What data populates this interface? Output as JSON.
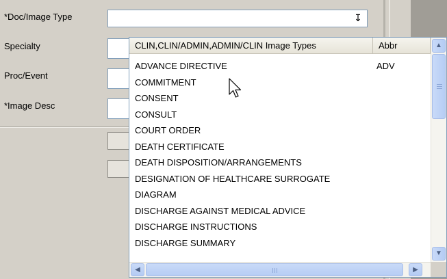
{
  "form": {
    "doc_image_type_label": "*Doc/Image Type",
    "specialty_label": "Specialty",
    "proc_event_label": "Proc/Event",
    "image_desc_label": "*Image Desc",
    "doc_image_type_value": ""
  },
  "dropdown": {
    "columns": [
      "CLIN,CLIN/ADMIN,ADMIN/CLIN Image Types",
      "Abbr"
    ],
    "rows": [
      {
        "name": "ADVANCE DIRECTIVE",
        "abbr": "ADV"
      },
      {
        "name": "COMMITMENT",
        "abbr": ""
      },
      {
        "name": "CONSENT",
        "abbr": ""
      },
      {
        "name": "CONSULT",
        "abbr": ""
      },
      {
        "name": "COURT ORDER",
        "abbr": ""
      },
      {
        "name": "DEATH CERTIFICATE",
        "abbr": ""
      },
      {
        "name": "DEATH DISPOSITION/ARRANGEMENTS",
        "abbr": ""
      },
      {
        "name": "DESIGNATION OF HEALTHCARE SURROGATE",
        "abbr": ""
      },
      {
        "name": "DIAGRAM",
        "abbr": ""
      },
      {
        "name": "DISCHARGE AGAINST MEDICAL ADVICE",
        "abbr": ""
      },
      {
        "name": "DISCHARGE INSTRUCTIONS",
        "abbr": ""
      },
      {
        "name": "DISCHARGE SUMMARY",
        "abbr": ""
      }
    ]
  },
  "icons": {
    "combo_arrow": "dropdown-arrow-icon",
    "cursor": "mouse-pointer-icon"
  }
}
